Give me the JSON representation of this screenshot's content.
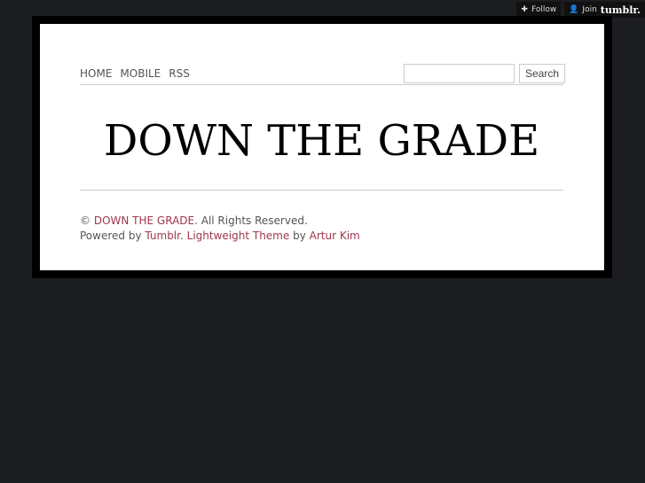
{
  "tumblr_bar": {
    "follow": "Follow",
    "join": "Join",
    "brand": "tumblr."
  },
  "nav": [
    "HOME",
    "MOBILE",
    "RSS"
  ],
  "search": {
    "value": "",
    "button": "Search"
  },
  "title": "DOWN THE GRADE",
  "footer": {
    "copy": "©",
    "site": "DOWN THE GRADE",
    "rights": ". All Rights Reserved.",
    "powered": "Powered by",
    "tumblr": "Tumblr",
    "dot": ".",
    "theme": "Lightweight Theme",
    "by": "by",
    "author": "Artur Kim"
  }
}
